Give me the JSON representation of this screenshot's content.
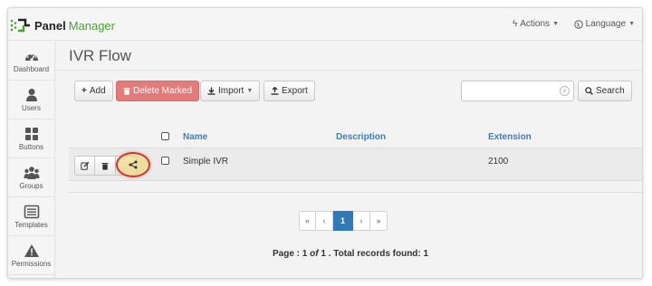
{
  "brand": {
    "name_a": "Panel",
    "name_b": "Manager"
  },
  "topbar": {
    "actions_label": "Actions",
    "language_label": "Language"
  },
  "sidebar": {
    "items": [
      {
        "label": "Dashboard",
        "icon": "dashboard-icon"
      },
      {
        "label": "Users",
        "icon": "user-icon"
      },
      {
        "label": "Buttons",
        "icon": "grid-icon"
      },
      {
        "label": "Groups",
        "icon": "group-icon"
      },
      {
        "label": "Templates",
        "icon": "template-icon"
      },
      {
        "label": "Permissions",
        "icon": "warning-icon"
      }
    ]
  },
  "page": {
    "title": "IVR Flow"
  },
  "toolbar": {
    "add_label": "Add",
    "delete_label": "Delete Marked",
    "import_label": "Import",
    "export_label": "Export",
    "search_label": "Search",
    "search_value": ""
  },
  "table": {
    "columns": [
      "Name",
      "Description",
      "Extension"
    ],
    "rows": [
      {
        "name": "Simple IVR",
        "description": "",
        "extension": "2100"
      }
    ]
  },
  "pagination": {
    "first": "«",
    "prev": "‹",
    "current": "1",
    "next": "›",
    "last": "»",
    "info_prefix": "Page : 1 ",
    "info_of": "of",
    "info_suffix": " 1 . Total records found: 1"
  },
  "colors": {
    "brand_green": "#4aa132",
    "delete_red": "#e37b7b",
    "link_blue": "#3a7ec6",
    "active_page": "#2f7ab8",
    "highlight_ring": "#c9392f"
  }
}
